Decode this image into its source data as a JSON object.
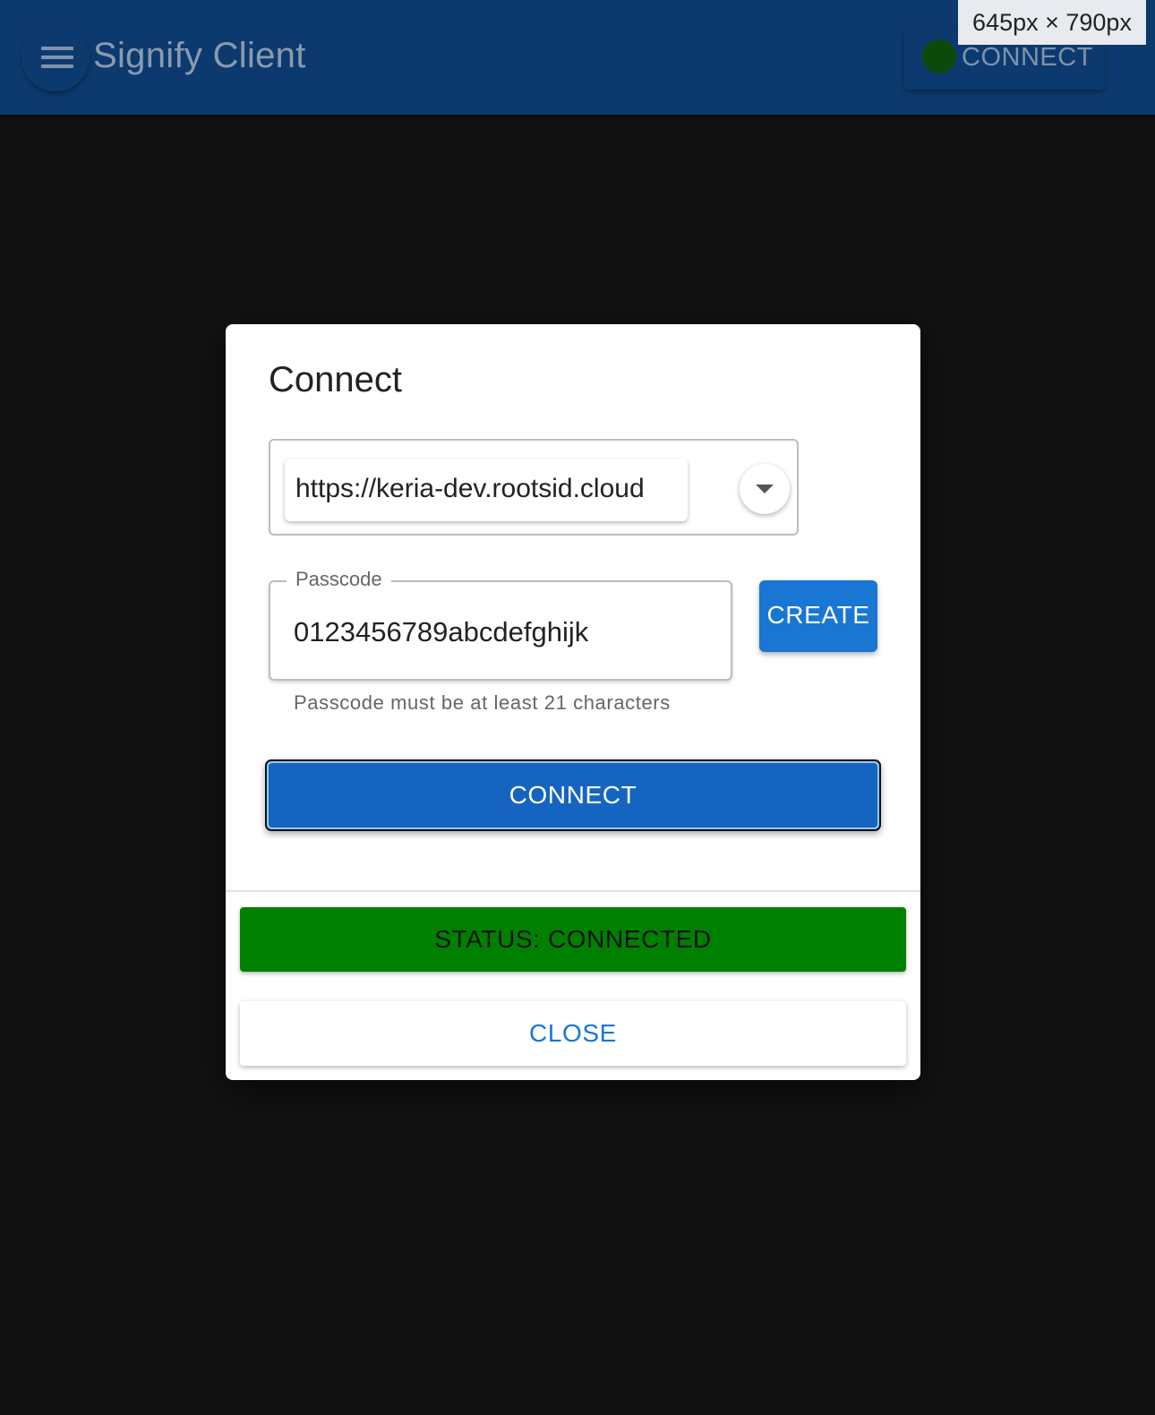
{
  "appbar": {
    "title": "Signify Client",
    "connect_label": "CONNECT",
    "status_dot_color": "#0b4a0b"
  },
  "viewport_badge": {
    "text": "645px × 790px"
  },
  "dialog": {
    "title": "Connect",
    "server": {
      "value": "https://keria-dev.rootsid.cloud"
    },
    "passcode": {
      "label": "Passcode",
      "value": "0123456789abcdefghijk",
      "helper": "Passcode must be at least 21 characters"
    },
    "create_label": "CREATE",
    "connect_label": "CONNECT",
    "status_text": "STATUS: CONNECTED",
    "status_color": "#008000",
    "close_label": "CLOSE"
  },
  "icons": {
    "menu": "menu-icon",
    "dropdown": "chevron-down-icon",
    "status": "status-dot-icon"
  }
}
